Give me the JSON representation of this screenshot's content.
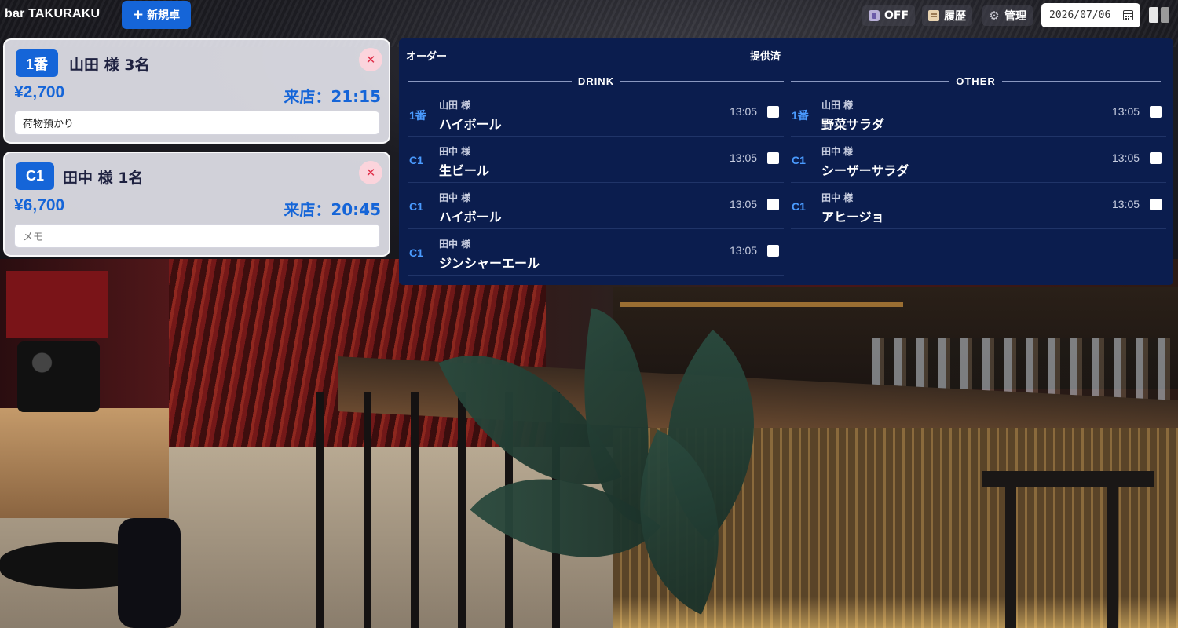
{
  "app": {
    "title": "bar TAKURAKU"
  },
  "toolbar": {
    "new_table_label": "新規卓",
    "power_label": "OFF",
    "history_label": "履歴",
    "admin_label": "管理",
    "date_value": "2026/07/06",
    "icons": [
      "plus-icon",
      "power-icon",
      "clipboard-icon",
      "gear-icon",
      "calendar-icon",
      "layout-toggle-icon"
    ]
  },
  "tables": [
    {
      "tag": "1番",
      "guest": "山田 様 3名",
      "price": "¥2,700",
      "arrival": "来店：21:15",
      "memo": "荷物預かり",
      "memo_placeholder": "メモ"
    },
    {
      "tag": "C1",
      "guest": "田中 様 1名",
      "price": "¥6,700",
      "arrival": "来店：20:45",
      "memo": "",
      "memo_placeholder": "メモ"
    }
  ],
  "orders": {
    "header_order": "オーダー",
    "header_served": "提供済",
    "drink": {
      "title": "DRINK",
      "items": [
        {
          "table": "1番",
          "who": "山田 様",
          "item": "ハイボール",
          "time": "13:05",
          "served": false
        },
        {
          "table": "C1",
          "who": "田中 様",
          "item": "生ビール",
          "time": "13:05",
          "served": false
        },
        {
          "table": "C1",
          "who": "田中 様",
          "item": "ハイボール",
          "time": "13:05",
          "served": false
        },
        {
          "table": "C1",
          "who": "田中 様",
          "item": "ジンシャーエール",
          "time": "13:05",
          "served": false
        }
      ]
    },
    "other": {
      "title": "OTHER",
      "items": [
        {
          "table": "1番",
          "who": "山田 様",
          "item": "野菜サラダ",
          "time": "13:05",
          "served": false
        },
        {
          "table": "C1",
          "who": "田中 様",
          "item": "シーザーサラダ",
          "time": "13:05",
          "served": false
        },
        {
          "table": "C1",
          "who": "田中 様",
          "item": "アヒージョ",
          "time": "13:05",
          "served": false
        }
      ]
    }
  },
  "colors": {
    "accent": "#1565d8",
    "panel": "#0b1d4e",
    "table_tag_text": "#4a9bff",
    "close": "#e0304a"
  }
}
